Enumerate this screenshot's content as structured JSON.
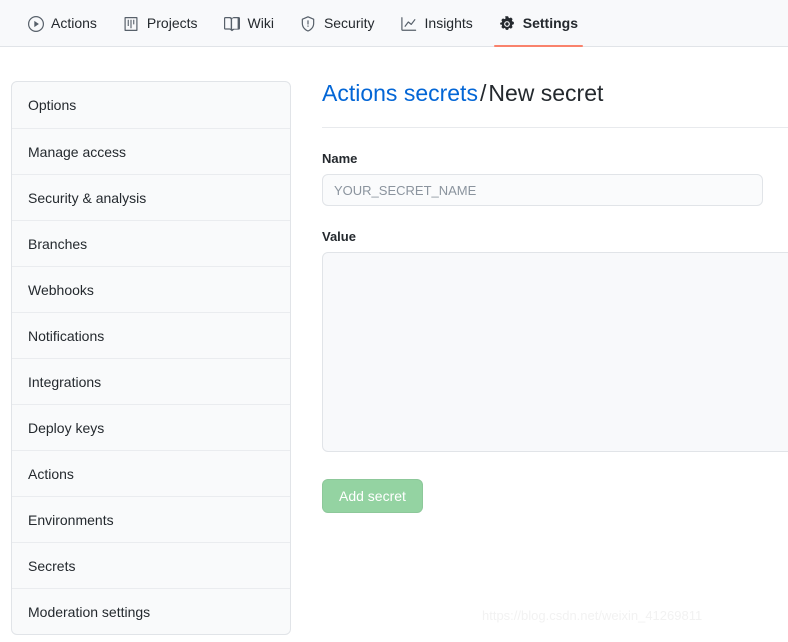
{
  "nav": {
    "items": [
      {
        "label": "Actions",
        "icon": "play-circle-icon",
        "active": false
      },
      {
        "label": "Projects",
        "icon": "project-board-icon",
        "active": false
      },
      {
        "label": "Wiki",
        "icon": "book-icon",
        "active": false
      },
      {
        "label": "Security",
        "icon": "shield-icon",
        "active": false
      },
      {
        "label": "Insights",
        "icon": "graph-icon",
        "active": false
      },
      {
        "label": "Settings",
        "icon": "gear-icon",
        "active": true
      }
    ],
    "active_underline_color": "#f9826c"
  },
  "sidebar": {
    "items": [
      {
        "label": "Options"
      },
      {
        "label": "Manage access"
      },
      {
        "label": "Security & analysis"
      },
      {
        "label": "Branches"
      },
      {
        "label": "Webhooks"
      },
      {
        "label": "Notifications"
      },
      {
        "label": "Integrations"
      },
      {
        "label": "Deploy keys"
      },
      {
        "label": "Actions"
      },
      {
        "label": "Environments"
      },
      {
        "label": "Secrets"
      },
      {
        "label": "Moderation settings"
      }
    ]
  },
  "main": {
    "title": {
      "link": "Actions secrets",
      "separator": "/",
      "current": "New secret",
      "link_color": "#0366d6"
    },
    "fields": {
      "name_label": "Name",
      "name_value": "",
      "name_placeholder": "YOUR_SECRET_NAME",
      "value_label": "Value",
      "value_value": "",
      "value_placeholder": ""
    },
    "submit": {
      "label": "Add secret",
      "color": "#94d3a2",
      "disabled": true
    }
  },
  "watermark": {
    "text": "https://blog.csdn.net/weixin_41269811"
  }
}
